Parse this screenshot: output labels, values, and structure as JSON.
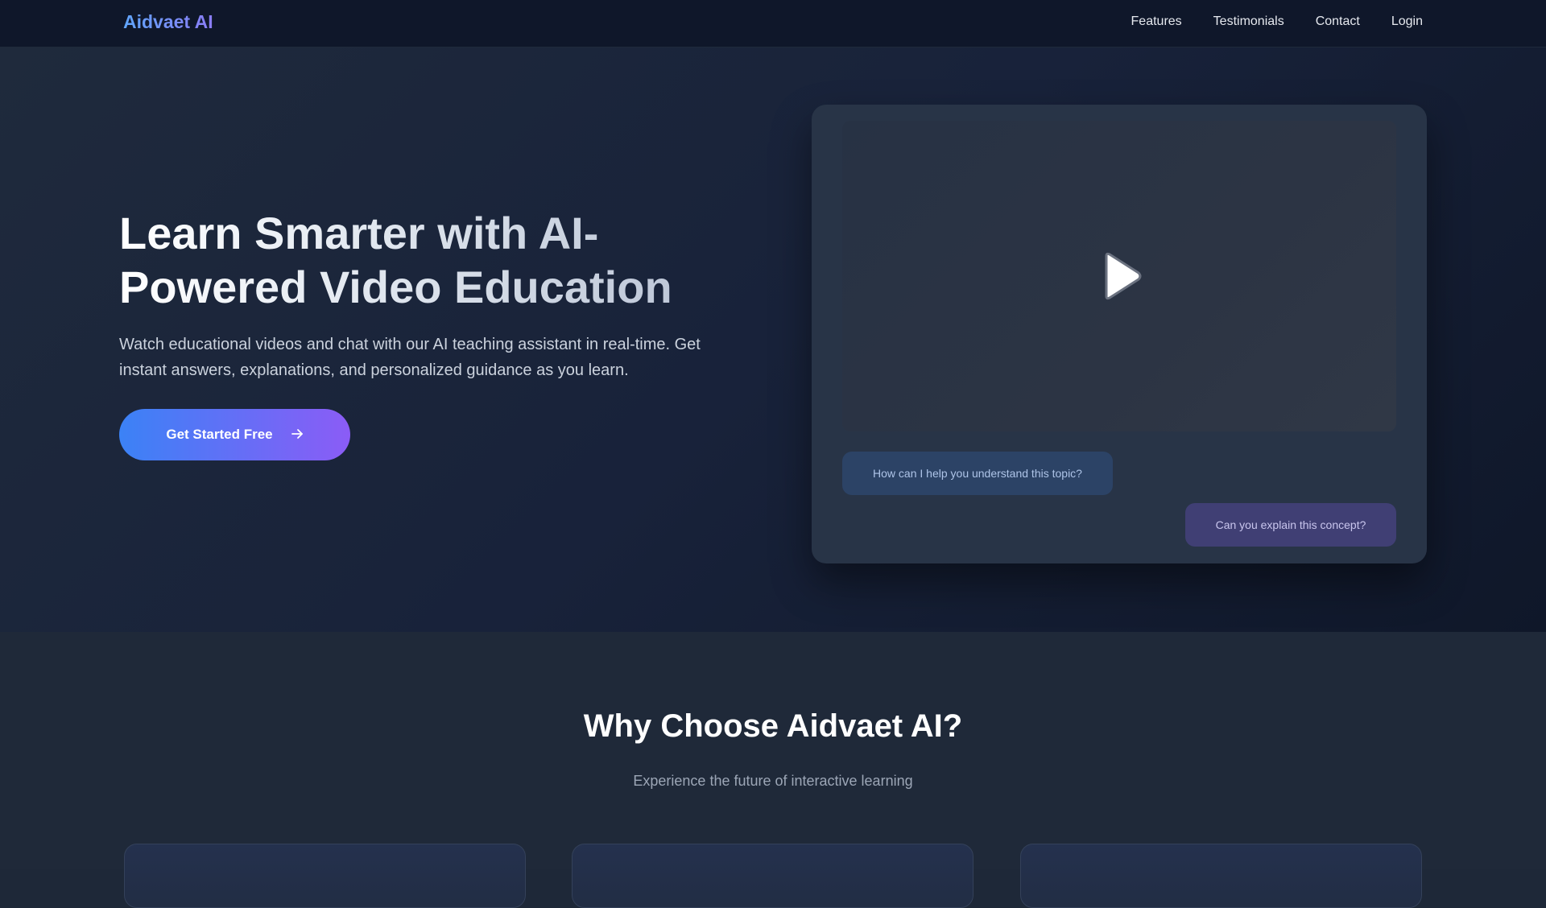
{
  "nav": {
    "brand": "Aidvaet AI",
    "links": [
      "Features",
      "Testimonials",
      "Contact",
      "Login"
    ]
  },
  "hero": {
    "title": "Learn Smarter with AI-Powered Video Education",
    "description": "Watch educational videos and chat with our AI teaching assistant in real-time. Get instant answers, explanations, and personalized guidance as you learn.",
    "cta_label": "Get Started Free",
    "cta_icon": "arrow-right-icon"
  },
  "video": {
    "play_icon": "play-icon",
    "ai_message": "How can I help you understand this topic?",
    "user_message": "Can you explain this concept?"
  },
  "features": {
    "title": "Why Choose Aidvaet AI?",
    "subtitle": "Experience the future of interactive learning"
  },
  "colors": {
    "nav_bg": "#0f172a",
    "accent_start": "#3b82f6",
    "accent_end": "#8b5cf6",
    "brand": "#7c9cf5"
  }
}
